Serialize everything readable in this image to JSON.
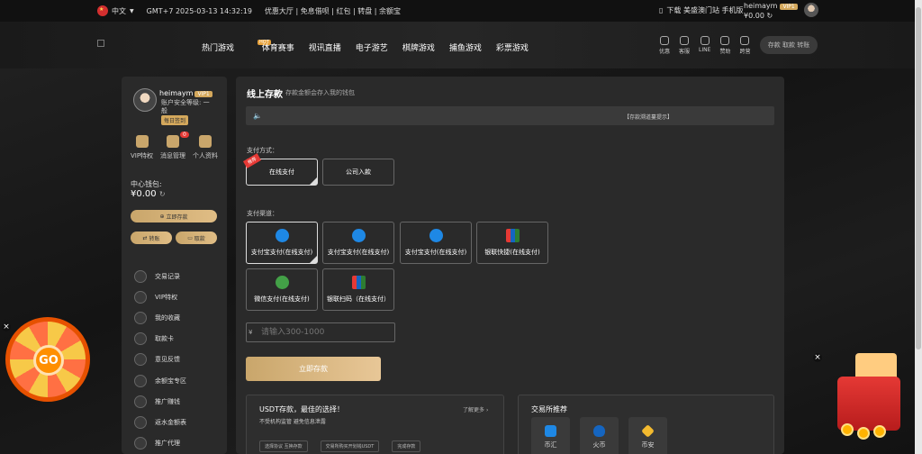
{
  "topbar": {
    "language": "中文",
    "time": "GMT+7 2025-03-13 14:32:19",
    "quick_links": "优惠大厅 | 免息借呗 | 红包 | 转盘 | 余额宝",
    "download": "下载 美盛澳门站 手机版",
    "username": "heimaym",
    "vip": "VIP1",
    "balance": "¥0.00"
  },
  "nav": {
    "items": [
      "热门游戏",
      "体育赛事",
      "视讯直播",
      "电子游艺",
      "棋牌游戏",
      "捕鱼游戏",
      "彩票游戏"
    ],
    "hot_tag": "HOT",
    "icons": [
      {
        "label": "优惠",
        "icon": "gift-icon"
      },
      {
        "label": "客服",
        "icon": "headset-icon"
      },
      {
        "label": "LINE",
        "icon": "chat-icon"
      },
      {
        "label": "赞助",
        "icon": "users-icon"
      },
      {
        "label": "跨营",
        "icon": "building-icon"
      }
    ],
    "deposit_withdraw": "存款 取款 转账"
  },
  "sidebar": {
    "username": "heimaym",
    "vip": "VIP1",
    "security": "账户安全等级: 一般",
    "daily": "每日签到",
    "tiles": [
      {
        "label": "VIP特权",
        "icon": "crown-icon"
      },
      {
        "label": "消息管理",
        "icon": "message-icon",
        "badge": "0"
      },
      {
        "label": "个人资料",
        "icon": "user-icon"
      }
    ],
    "wallet_label": "中心钱包:",
    "wallet_value": "¥0.00",
    "deposit_btn": "立即存款",
    "transfer_btn": "转账",
    "withdraw_btn": "取款",
    "menu": [
      "交易记录",
      "VIP特权",
      "我的收藏",
      "取款卡",
      "意见反馈",
      "余额宝专区",
      "推广赚钱",
      "返水金额表",
      "推广代理"
    ]
  },
  "main": {
    "title": "线上存款",
    "subtitle": "存款金额会存入我的钱包",
    "notice": "【存款溯道蔓提示】",
    "payment_label": "支付方式：",
    "payment_methods": [
      "在线支付",
      "公司入款"
    ],
    "recommend_tag": "推荐",
    "channel_label": "支付渠道：",
    "channels": [
      {
        "label": "支付宝支付(在线支付)",
        "icon": "alipay-icon"
      },
      {
        "label": "支付宝支付(在线支付)",
        "icon": "alipay-icon"
      },
      {
        "label": "支付宝支付(在线支付)",
        "icon": "alipay-icon"
      },
      {
        "label": "银联快捷(在线支付)",
        "icon": "unionpay-icon"
      },
      {
        "label": "微信支付(在线支付)",
        "icon": "wechat-icon"
      },
      {
        "label": "银联扫码（在线支付）",
        "icon": "unionpay-icon"
      }
    ],
    "amount_prefix": "¥",
    "amount_placeholder": "请输入300-1000",
    "submit": "立即存款",
    "usdt": {
      "title": "USDT存款，最佳的选择！",
      "more": "了解更多",
      "desc": "不受机构监管 避免信息泄露",
      "links": [
        "选择协议 互换存款",
        "交易所购买开划钱USDT",
        "完成存款"
      ]
    },
    "exchange": {
      "title": "交易所推荐",
      "items": [
        {
          "label": "币汇",
          "icon": "bihui-icon"
        },
        {
          "label": "火币",
          "icon": "huobi-icon"
        },
        {
          "label": "币安",
          "icon": "binance-icon"
        }
      ]
    }
  },
  "floating": {
    "wheel_label": "GO"
  },
  "colors": {
    "accent": "#d4a85c",
    "background": "#1c1c1c",
    "panel": "#2a2a2a"
  }
}
